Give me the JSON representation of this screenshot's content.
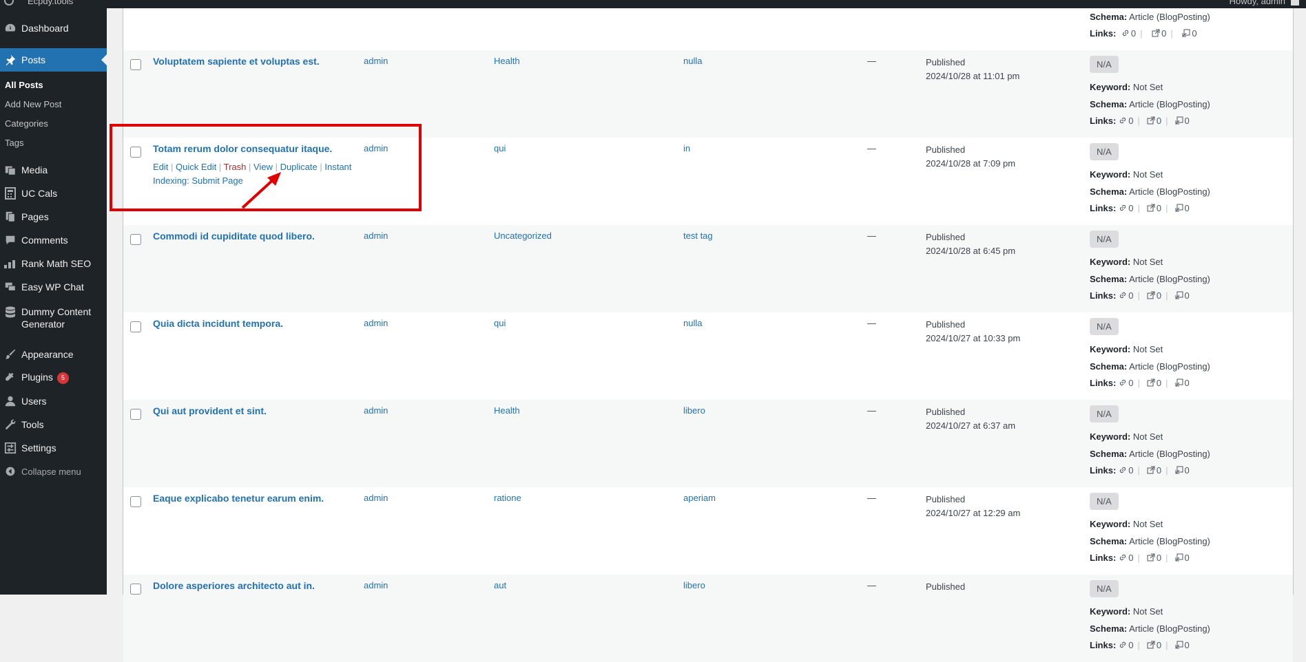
{
  "admin_bar": {
    "site": "Ecpdy.tools",
    "howdy": "Howdy, admin"
  },
  "sidebar": {
    "items": [
      {
        "label": "Dashboard",
        "icon": "dashboard-icon"
      },
      {
        "label": "Posts",
        "icon": "pin-icon"
      },
      {
        "label": "Media",
        "icon": "media-icon"
      },
      {
        "label": "UC Cals",
        "icon": "calculator-icon"
      },
      {
        "label": "Pages",
        "icon": "pages-icon"
      },
      {
        "label": "Comments",
        "icon": "comments-icon"
      },
      {
        "label": "Rank Math SEO",
        "icon": "rankmath-icon"
      },
      {
        "label": "Easy WP Chat",
        "icon": "chat-icon"
      },
      {
        "label": "Dummy Content Generator",
        "icon": "database-icon"
      },
      {
        "label": "Appearance",
        "icon": "brush-icon"
      },
      {
        "label": "Plugins",
        "icon": "plugin-icon",
        "badge": "5"
      },
      {
        "label": "Users",
        "icon": "users-icon"
      },
      {
        "label": "Tools",
        "icon": "wrench-icon"
      },
      {
        "label": "Settings",
        "icon": "settings-icon"
      },
      {
        "label": "Collapse menu",
        "icon": "collapse-icon"
      }
    ],
    "posts_submenu": [
      "All Posts",
      "Add New Post",
      "Categories",
      "Tags"
    ]
  },
  "top_partial": {
    "schema_label": "Schema:",
    "schema_value": "Article (BlogPosting)",
    "links_label": "Links:",
    "links": [
      "0",
      "0",
      "0"
    ]
  },
  "rows": [
    {
      "title": "Voluptatem sapiente et voluptas est.",
      "author": "admin",
      "category": "Health",
      "tag": "nulla",
      "comments": "—",
      "status": "Published",
      "date": "2024/10/28 at 11:01 pm"
    },
    {
      "title": "Totam rerum dolor consequatur itaque.",
      "author": "admin",
      "category": "qui",
      "tag": "in",
      "comments": "—",
      "status": "Published",
      "date": "2024/10/28 at 7:09 pm"
    },
    {
      "title": "Commodi id cupiditate quod libero.",
      "author": "admin",
      "category": "Uncategorized",
      "tag": "test tag",
      "comments": "—",
      "status": "Published",
      "date": "2024/10/28 at 6:45 pm"
    },
    {
      "title": "Quia dicta incidunt tempora.",
      "author": "admin",
      "category": "qui",
      "tag": "nulla",
      "comments": "—",
      "status": "Published",
      "date": "2024/10/27 at 10:33 pm"
    },
    {
      "title": "Qui aut provident et sint.",
      "author": "admin",
      "category": "Health",
      "tag": "libero",
      "comments": "—",
      "status": "Published",
      "date": "2024/10/27 at 6:37 am"
    },
    {
      "title": "Eaque explicabo tenetur earum enim.",
      "author": "admin",
      "category": "ratione",
      "tag": "aperiam",
      "comments": "—",
      "status": "Published",
      "date": "2024/10/27 at 12:29 am"
    },
    {
      "title": "Dolore asperiores architecto aut in.",
      "author": "admin",
      "category": "aut",
      "tag": "libero",
      "comments": "—",
      "status": "Published",
      "date": ""
    }
  ],
  "seo": {
    "score": "N/A",
    "keyword_label": "Keyword:",
    "keyword_value": "Not Set",
    "schema_label": "Schema:",
    "schema_value": "Article (BlogPosting)",
    "links_label": "Links:",
    "links": [
      "0",
      "0",
      "0"
    ]
  },
  "row_actions": {
    "edit": "Edit",
    "quick_edit": "Quick Edit",
    "trash": "Trash",
    "view": "View",
    "duplicate": "Duplicate",
    "instant": "Instant",
    "indexing": "Indexing: Submit Page"
  },
  "colors": {
    "admin_dark": "#1d2327",
    "wp_blue": "#2271b1",
    "highlight_red": "#e00000"
  }
}
